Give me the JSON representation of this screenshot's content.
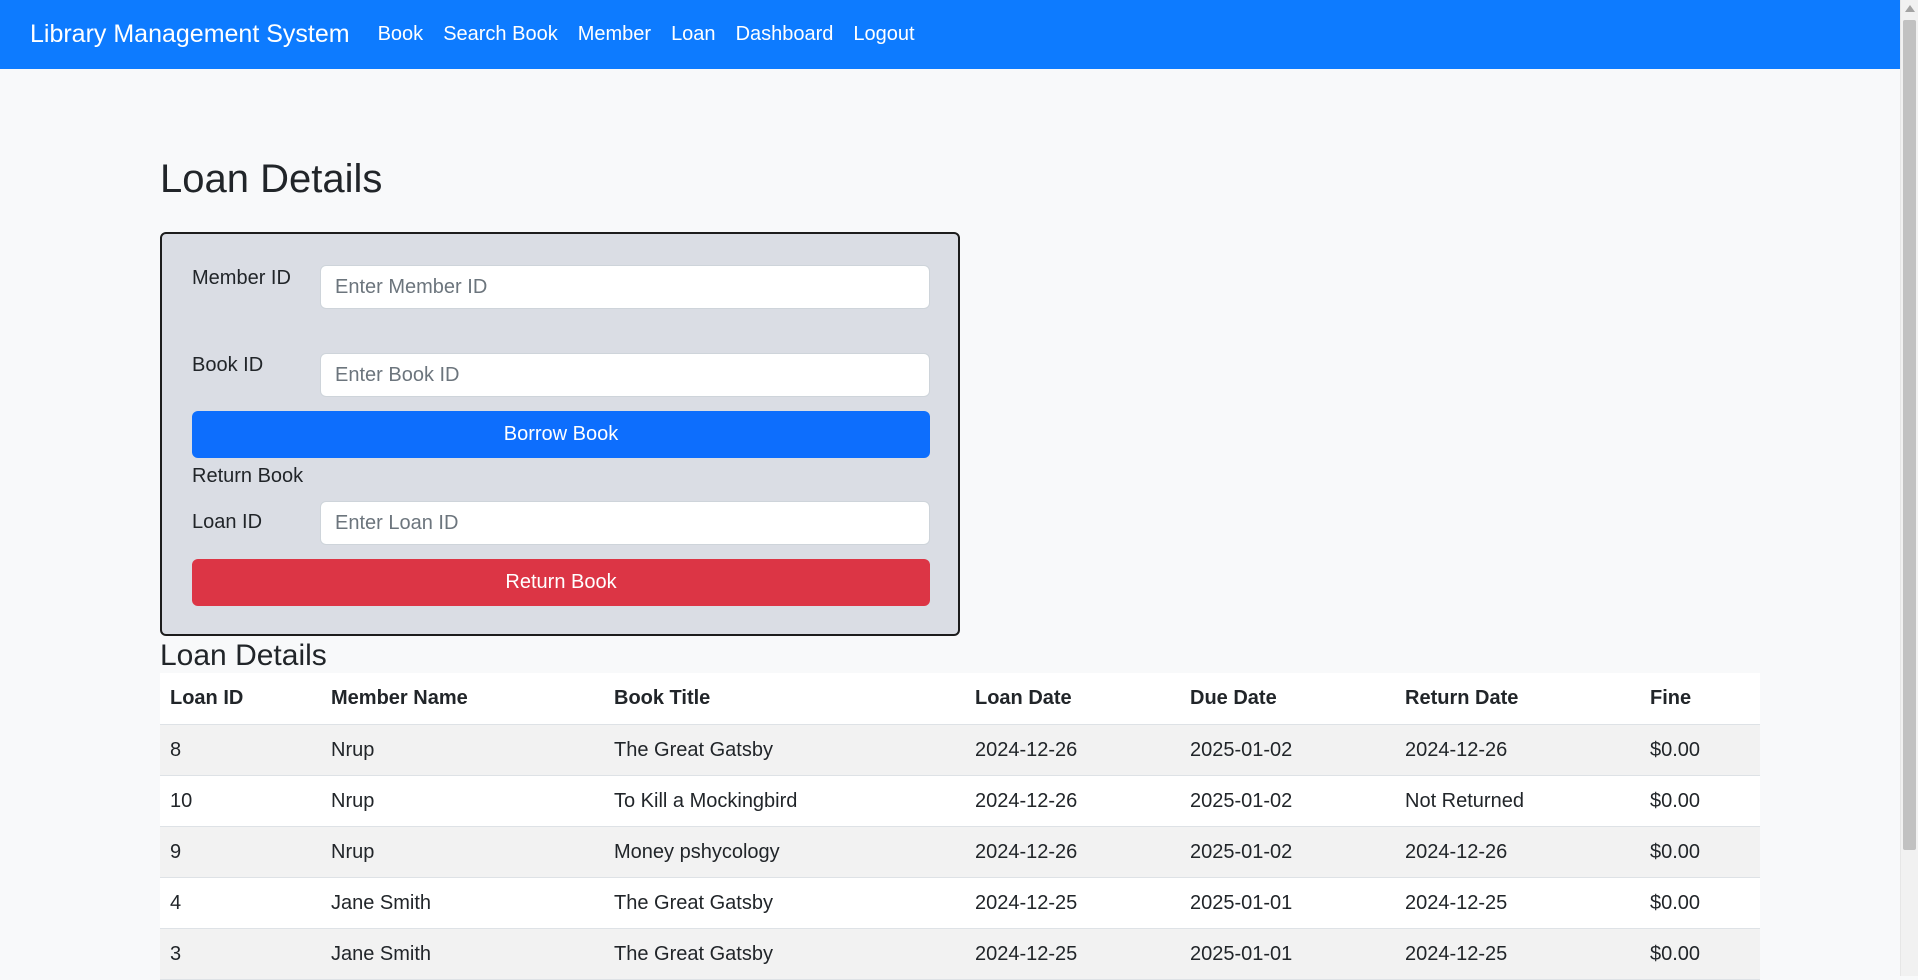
{
  "navbar": {
    "brand": "Library Management System",
    "links": [
      "Book",
      "Search Book",
      "Member",
      "Loan",
      "Dashboard",
      "Logout"
    ],
    "background_color": "#0d7bff"
  },
  "page": {
    "title": "Loan Details"
  },
  "form": {
    "member_id_label": "Member ID",
    "member_id_placeholder": "Enter Member ID",
    "book_id_label": "Book ID",
    "book_id_placeholder": "Enter Book ID",
    "borrow_button": "Borrow Book",
    "return_section_label": "Return Book",
    "loan_id_label": "Loan ID",
    "loan_id_placeholder": "Enter Loan ID",
    "return_button": "Return Book",
    "borrow_color": "#0d6efd",
    "return_color": "#dc3545"
  },
  "table": {
    "title": "Loan Details",
    "headers": [
      "Loan ID",
      "Member Name",
      "Book Title",
      "Loan Date",
      "Due Date",
      "Return Date",
      "Fine"
    ],
    "rows": [
      [
        "8",
        "Nrup",
        "The Great Gatsby",
        "2024-12-26",
        "2025-01-02",
        "2024-12-26",
        "$0.00"
      ],
      [
        "10",
        "Nrup",
        "To Kill a Mockingbird",
        "2024-12-26",
        "2025-01-02",
        "Not Returned",
        "$0.00"
      ],
      [
        "9",
        "Nrup",
        "Money pshycology",
        "2024-12-26",
        "2025-01-02",
        "2024-12-26",
        "$0.00"
      ],
      [
        "4",
        "Jane Smith",
        "The Great Gatsby",
        "2024-12-25",
        "2025-01-01",
        "2024-12-25",
        "$0.00"
      ],
      [
        "3",
        "Jane Smith",
        "The Great Gatsby",
        "2024-12-25",
        "2025-01-01",
        "2024-12-25",
        "$0.00"
      ]
    ]
  }
}
